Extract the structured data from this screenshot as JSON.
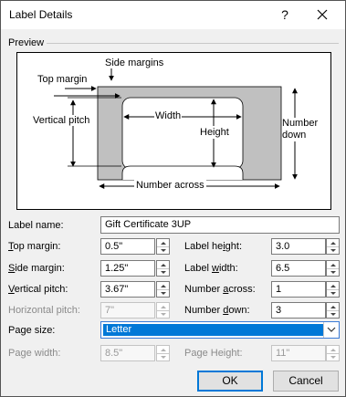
{
  "window": {
    "title": "Label Details",
    "help_glyph": "?"
  },
  "preview": {
    "section_label": "Preview",
    "diagram": {
      "side_margins": "Side margins",
      "top_margin": "Top margin",
      "width": "Width",
      "vertical_pitch": "Vertical pitch",
      "height": "Height",
      "number_down": "Number\ndown",
      "number_across": "Number across"
    }
  },
  "fields": {
    "label_name": {
      "label": "Label name:",
      "value": "Gift Certificate 3UP"
    },
    "top_margin": {
      "label_pre": "",
      "label_ul": "T",
      "label_post": "op margin:",
      "value": "0.5\""
    },
    "side_margin": {
      "label_pre": "",
      "label_ul": "S",
      "label_post": "ide margin:",
      "value": "1.25\""
    },
    "vertical_pitch": {
      "label_pre": "",
      "label_ul": "V",
      "label_post": "ertical pitch:",
      "value": "3.67\""
    },
    "horizontal_pitch": {
      "label": "Horizontal pitch:",
      "value": "7\""
    },
    "label_height": {
      "label_pre": "Label he",
      "label_ul": "i",
      "label_post": "ght:",
      "value": "3.0"
    },
    "label_width": {
      "label_pre": "Label ",
      "label_ul": "w",
      "label_post": "idth:",
      "value": "6.5"
    },
    "number_across": {
      "label_pre": "Number ",
      "label_ul": "a",
      "label_post": "cross:",
      "value": "1"
    },
    "number_down": {
      "label_pre": "Number ",
      "label_ul": "d",
      "label_post": "own:",
      "value": "3"
    },
    "page_size": {
      "label": "Page size:",
      "value": "Letter"
    },
    "page_width": {
      "label": "Page width:",
      "value": "8.5\""
    },
    "page_height": {
      "label": "Page Height:",
      "value": "11\""
    }
  },
  "buttons": {
    "ok": "OK",
    "cancel": "Cancel"
  },
  "colors": {
    "accent": "#0078d7",
    "sheet_gray": "#c0c0c0"
  },
  "icons": {
    "close": "close-icon",
    "dropdown": "chevron-down-icon",
    "spin_up": "spin-up-icon",
    "spin_down": "spin-down-icon"
  }
}
